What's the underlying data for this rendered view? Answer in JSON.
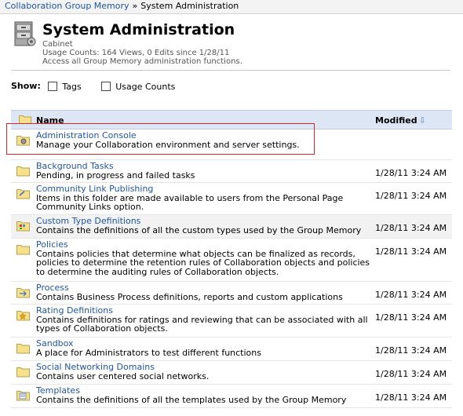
{
  "breadcrumb": {
    "parent": "Collaboration Group Memory",
    "separator": "»",
    "current": "System Administration"
  },
  "header": {
    "title": "System Administration",
    "type": "Cabinet",
    "usage": "Usage Counts: 164 Views, 0 Edits since 1/28/11",
    "description": "Access all Group Memory administration functions."
  },
  "show": {
    "label": "Show:",
    "options": [
      "Tags",
      "Usage Counts"
    ]
  },
  "columns": {
    "name": "Name",
    "modified": "Modified",
    "sort_icon": "sort-desc-icon"
  },
  "rows": [
    {
      "name": "Administration Console",
      "desc": "Manage your Collaboration environment and server settings.",
      "date": "",
      "icon": "admin-folder-icon"
    },
    {
      "name": "Background Tasks",
      "desc": "Pending, in progress and failed tasks",
      "date": "1/28/11 3:24 AM",
      "icon": "folder-icon"
    },
    {
      "name": "Community Link Publishing",
      "desc": "Items in this folder are made available to users from the Personal Page Community Links option.",
      "date": "1/28/11 3:24 AM",
      "icon": "link-folder-icon"
    },
    {
      "name": "Custom Type Definitions",
      "desc": "Contains the definitions of all the custom types used by the Group Memory",
      "date": "1/28/11 3:24 AM",
      "icon": "types-folder-icon"
    },
    {
      "name": "Policies",
      "desc": "Contains policies that determine what objects can be finalized as records, policies to determine the retention rules of Collaboration objects and policies to determine the auditing rules of Collaboration objects.",
      "date": "1/28/11 3:24 AM",
      "icon": "folder-icon"
    },
    {
      "name": "Process",
      "desc": "Contains Business Process definitions, reports and custom applications",
      "date": "1/28/11 3:24 AM",
      "icon": "process-folder-icon"
    },
    {
      "name": "Rating Definitions",
      "desc": "Contains definitions for ratings and reviewing that can be associated with all types of Collaboration objects.",
      "date": "1/28/11 3:24 AM",
      "icon": "rating-folder-icon"
    },
    {
      "name": "Sandbox",
      "desc": "A place for Administrators to test different functions",
      "date": "1/28/11 3:24 AM",
      "icon": "folder-icon"
    },
    {
      "name": "Social Networking Domains",
      "desc": "Contains user centered social networks.",
      "date": "1/28/11 3:24 AM",
      "icon": "folder-icon"
    },
    {
      "name": "Templates",
      "desc": "Contains the definitions of all the templates used by the Group Memory",
      "date": "1/28/11 3:24 AM",
      "icon": "template-folder-icon"
    }
  ]
}
